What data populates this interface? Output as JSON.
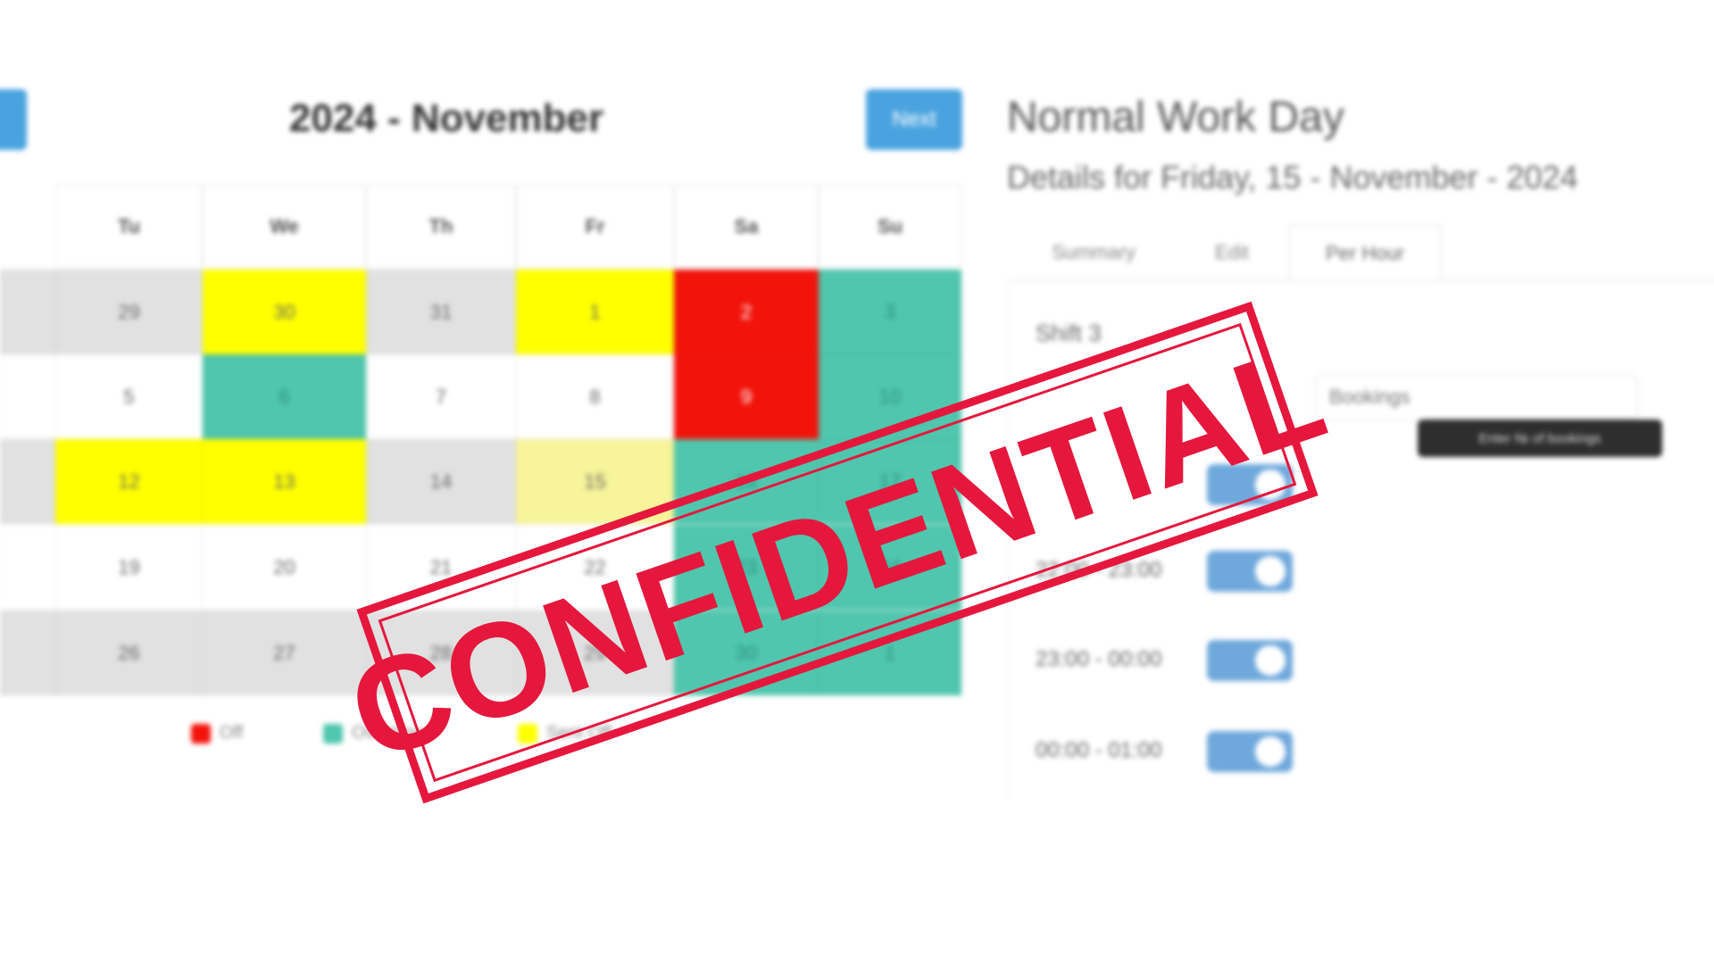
{
  "calendar": {
    "month_title": "2024 - November",
    "next_button": "Next",
    "weekday_headers": [
      "Tu",
      "We",
      "Th",
      "Fr",
      "Sa",
      "Su"
    ],
    "rows": [
      [
        "29",
        "30",
        "31",
        "1",
        "2",
        "3"
      ],
      [
        "5",
        "6",
        "7",
        "8",
        "9",
        "10"
      ],
      [
        "12",
        "13",
        "14",
        "15",
        "16",
        "17"
      ],
      [
        "19",
        "20",
        "21",
        "22",
        "23",
        "24"
      ],
      [
        "26",
        "27",
        "28",
        "29",
        "30",
        "1"
      ]
    ],
    "legend": [
      {
        "label": "Off",
        "color": "#f2130b"
      },
      {
        "label": "Overtime",
        "color": "#4fc6ad"
      },
      {
        "label": "Sent Off",
        "color": "#ffff00"
      }
    ]
  },
  "colors": {
    "grey": "#e1e1e1",
    "white": "#ffffff",
    "yellow": "#ffff00",
    "pale_yellow": "#f7f49a",
    "red": "#f2130b",
    "teal": "#4fc6ad",
    "accent": "#4aa3df"
  },
  "details": {
    "title": "Normal Work Day",
    "subtitle": "Details for Friday, 15 - November - 2024",
    "tabs": [
      "Summary",
      "Edit",
      "Per Hour"
    ],
    "shift_label": "Shift 3",
    "bookings_placeholder": "Bookings",
    "tooltip": "Enter № of bookings",
    "time_slots": [
      "22:00 - 23:00",
      "23:00 - 00:00",
      "00:00 - 01:00"
    ]
  },
  "stamp": {
    "text": "CONFIDENTIAL"
  }
}
